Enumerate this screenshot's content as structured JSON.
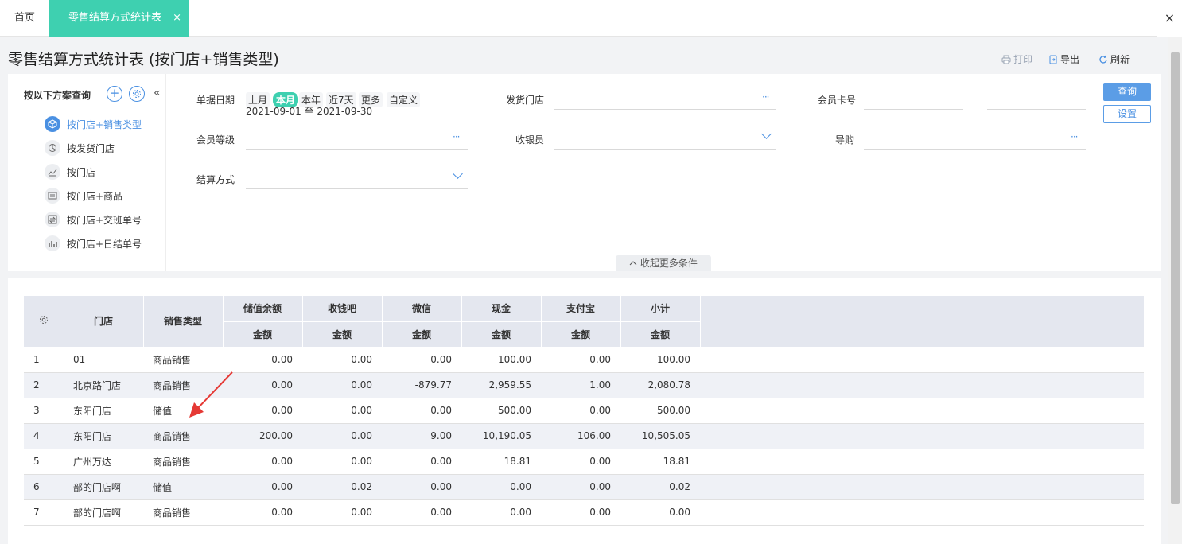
{
  "tabs": {
    "home": "首页",
    "active": "零售结算方式统计表",
    "active_close": "×",
    "close_all": "×"
  },
  "page": {
    "title": "零售结算方式统计表 (按门店+销售类型)"
  },
  "toolbar": {
    "print": "打印",
    "export": "导出",
    "refresh": "刷新"
  },
  "scheme": {
    "header": "按以下方案查询",
    "add": "+",
    "collapse": "«",
    "items": [
      {
        "label": "按门店+销售类型",
        "icon": "cube-icon",
        "active": true
      },
      {
        "label": "按发货门店",
        "icon": "pie-chart-icon",
        "active": false
      },
      {
        "label": "按门店",
        "icon": "line-chart-icon",
        "active": false
      },
      {
        "label": "按门店+商品",
        "icon": "list-icon",
        "active": false
      },
      {
        "label": "按门店+交班单号",
        "icon": "exchange-icon",
        "active": false
      },
      {
        "label": "按门店+日结单号",
        "icon": "bar-chart-icon",
        "active": false
      }
    ]
  },
  "filters": {
    "doc_date": "单据日期",
    "date_options": [
      "上月",
      "本月",
      "本年",
      "近7天",
      "更多",
      "自定义"
    ],
    "date_selected": "本月",
    "date_range": "2021-09-01 至 2021-09-30",
    "ship_store": "发货门店",
    "member_card": "会员卡号",
    "range_sep": "—",
    "member_level": "会员等级",
    "cashier": "收银员",
    "guide": "导购",
    "settle_method": "结算方式",
    "dots": "···",
    "query_btn": "查询",
    "settings_btn": "设置",
    "more_toggle": "收起更多条件"
  },
  "table": {
    "group_headers": [
      "门店",
      "销售类型"
    ],
    "pay_columns": [
      "储值余额",
      "收钱吧",
      "微信",
      "现金",
      "支付宝",
      "小计"
    ],
    "sub_header": "金额",
    "rows": [
      {
        "no": "1",
        "store": "01",
        "type": "商品销售",
        "vals": [
          "0.00",
          "0.00",
          "0.00",
          "100.00",
          "0.00",
          "100.00"
        ]
      },
      {
        "no": "2",
        "store": "北京路门店",
        "type": "商品销售",
        "vals": [
          "0.00",
          "0.00",
          "-879.77",
          "2,959.55",
          "1.00",
          "2,080.78"
        ]
      },
      {
        "no": "3",
        "store": "东阳门店",
        "type": "储值",
        "vals": [
          "0.00",
          "0.00",
          "0.00",
          "500.00",
          "0.00",
          "500.00"
        ]
      },
      {
        "no": "4",
        "store": "东阳门店",
        "type": "商品销售",
        "vals": [
          "200.00",
          "0.00",
          "9.00",
          "10,190.05",
          "106.00",
          "10,505.05"
        ]
      },
      {
        "no": "5",
        "store": "广州万达",
        "type": "商品销售",
        "vals": [
          "0.00",
          "0.00",
          "0.00",
          "18.81",
          "0.00",
          "18.81"
        ]
      },
      {
        "no": "6",
        "store": "部的门店啊",
        "type": "储值",
        "vals": [
          "0.00",
          "0.02",
          "0.00",
          "0.00",
          "0.00",
          "0.02"
        ]
      },
      {
        "no": "7",
        "store": "部的门店啊",
        "type": "商品销售",
        "vals": [
          "0.00",
          "0.00",
          "0.00",
          "0.00",
          "0.00",
          "0.00"
        ]
      }
    ]
  },
  "colors": {
    "accent": "#3ed0b0",
    "primary": "#4a90e2",
    "negative": "#e53935",
    "header_bg": "#e4e7ef",
    "annotation_arrow": "#e53935"
  }
}
